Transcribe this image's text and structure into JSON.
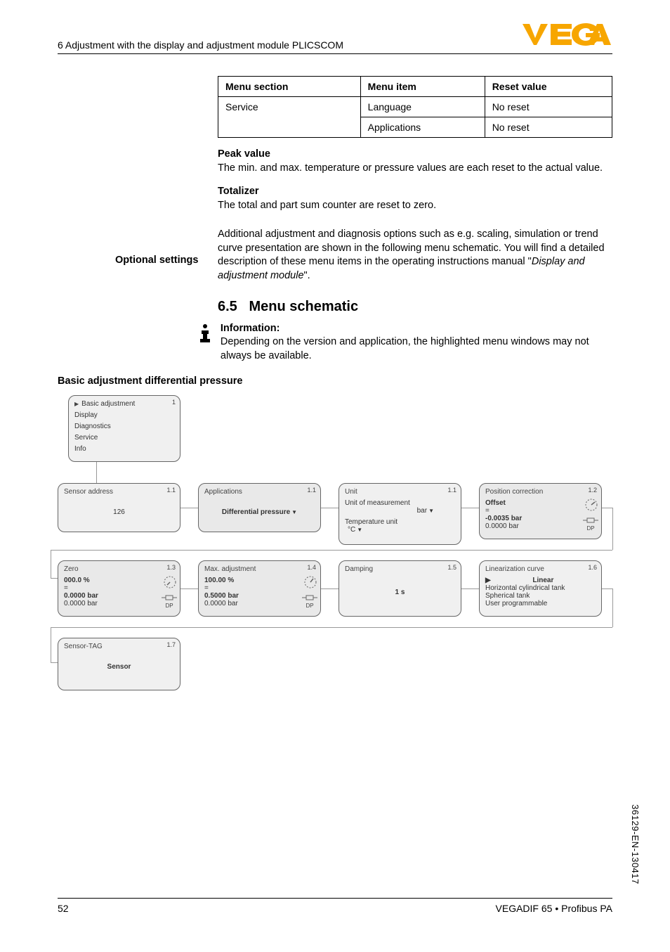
{
  "header": {
    "breadcrumb": "6 Adjustment with the display and adjustment module PLICSCOM"
  },
  "logo": {
    "brand": "VEGA",
    "color": "#F7A600"
  },
  "table": {
    "headers": [
      "Menu section",
      "Menu item",
      "Reset value"
    ],
    "rows": [
      [
        "Service",
        "Language",
        "No reset"
      ],
      [
        "",
        "Applications",
        "No reset"
      ]
    ]
  },
  "peak": {
    "title": "Peak value",
    "body": "The min. and max. temperature or pressure values are each reset to the actual value."
  },
  "totalizer": {
    "title": "Totalizer",
    "body": "The total and part sum counter are reset to zero."
  },
  "optional": {
    "side": "Optional settings",
    "body_pre": "Additional adjustment and diagnosis options such as e.g. scaling, simulation or trend curve presentation are shown in the following menu schematic. You will find a detailed description of these menu items in the operating instructions manual \"",
    "body_em": "Display and adjustment module",
    "body_post": "\"."
  },
  "h65": {
    "num": "6.5",
    "title": "Menu schematic"
  },
  "info": {
    "title": "Information:",
    "body": "Depending on the version and application, the highlighted menu windows may not always be available."
  },
  "subhead": "Basic adjustment differential pressure",
  "menu_card": {
    "num": "1",
    "items": [
      "Basic adjustment",
      "Display",
      "Diagnostics",
      "Service",
      "Info"
    ]
  },
  "cards": {
    "c11a": {
      "num": "1.1",
      "title": "Sensor address",
      "value": "126"
    },
    "c11b": {
      "num": "1.1",
      "title": "Applications",
      "value": "Differential pressure"
    },
    "c11c": {
      "num": "1.1",
      "title": "Unit",
      "l1": "Unit of measurement",
      "v1": "bar",
      "l2": "Temperature unit",
      "v2": "°C"
    },
    "c12": {
      "num": "1.2",
      "title": "Position correction",
      "l1": "Offset",
      "l2": "=",
      "v1": "-0.0035 bar",
      "v2": "0.0000 bar"
    },
    "c13": {
      "num": "1.3",
      "title": "Zero",
      "l1": "000.0 %",
      "l2": "=",
      "v1": "0.0000 bar",
      "v2": "0.0000 bar"
    },
    "c14": {
      "num": "1.4",
      "title": "Max. adjustment",
      "l1": "100.00 %",
      "l2": "=",
      "v1": "0.5000 bar",
      "v2": "0.0000 bar"
    },
    "c15": {
      "num": "1.5",
      "title": "Damping",
      "value": "1 s"
    },
    "c16": {
      "num": "1.6",
      "title": "Linearization curve",
      "v1": "Linear",
      "v2": "Horizontal cylindrical tank",
      "v3": "Spherical tank",
      "v4": "User programmable"
    },
    "c17": {
      "num": "1.7",
      "title": "Sensor-TAG",
      "value": "Sensor"
    }
  },
  "footer": {
    "page": "52",
    "doc": "VEGADIF 65 • Profibus PA"
  },
  "sidecode": "36129-EN-130417"
}
